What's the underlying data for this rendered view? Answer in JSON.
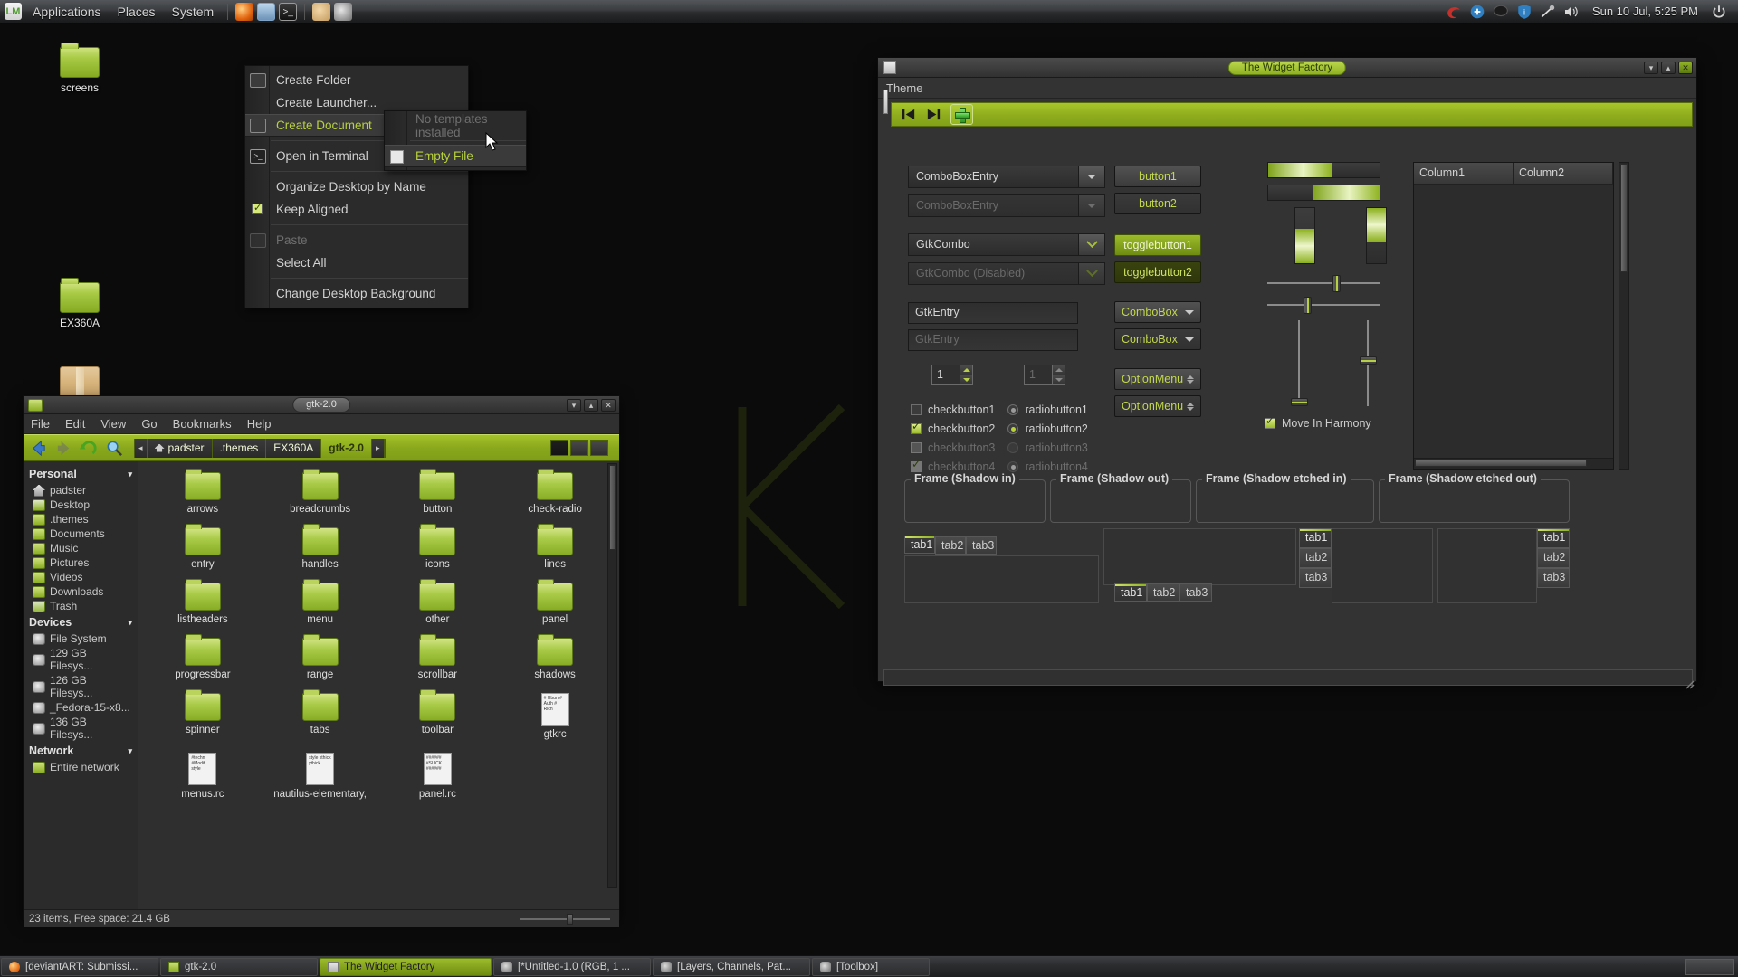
{
  "top_panel": {
    "logo": "lm-logo-icon",
    "menus": [
      "Applications",
      "Places",
      "System"
    ],
    "launchers": [
      "firefox-icon",
      "mail-icon",
      "terminal-icon",
      "gimp-icon",
      "color-picker-icon"
    ],
    "tray_icons": [
      "shutter-icon",
      "update-manager-icon",
      "chat-icon",
      "shield-icon",
      "network-icon",
      "volume-icon"
    ],
    "clock": "Sun 10 Jul,  5:25 PM",
    "power": "power-icon"
  },
  "desktop": {
    "icons": [
      {
        "label": "screens",
        "type": "folder"
      },
      {
        "label": "EX360A",
        "type": "folder"
      },
      {
        "label": "",
        "type": "archive"
      }
    ]
  },
  "context_menu": {
    "items": [
      {
        "label": "Create Folder",
        "icon": "new-folder-icon",
        "state": "normal",
        "mnemonic": "F"
      },
      {
        "label": "Create Launcher...",
        "icon": "",
        "state": "normal",
        "mnemonic": "L"
      },
      {
        "label": "Create Document",
        "icon": "new-document-icon",
        "state": "selected",
        "mnemonic": "D",
        "submenu": true
      },
      {
        "separator": true
      },
      {
        "label": "Open in Terminal",
        "icon": "terminal-icon",
        "state": "normal",
        "mnemonic": "T"
      },
      {
        "separator": true
      },
      {
        "label": "Organize Desktop by Name",
        "icon": "",
        "state": "normal",
        "mnemonic": "O"
      },
      {
        "label": "Keep Aligned",
        "icon": "checkbox-checked",
        "state": "normal",
        "mnemonic": "K"
      },
      {
        "separator": true
      },
      {
        "label": "Paste",
        "icon": "paste-icon",
        "state": "disabled",
        "mnemonic": "P"
      },
      {
        "label": "Select All",
        "icon": "",
        "state": "normal",
        "mnemonic": "A"
      },
      {
        "separator": true
      },
      {
        "label": "Change Desktop Background",
        "icon": "",
        "state": "normal",
        "mnemonic": "B"
      }
    ]
  },
  "context_submenu": {
    "items": [
      {
        "label": "No templates installed",
        "state": "disabled"
      },
      {
        "separator": true
      },
      {
        "label": "Empty File",
        "icon": "empty-file-icon",
        "state": "selected",
        "mnemonic": "E"
      }
    ]
  },
  "nautilus": {
    "title": "gtk-2.0",
    "window_buttons": [
      "minimize",
      "maximize",
      "close"
    ],
    "menubar": [
      "File",
      "Edit",
      "View",
      "Go",
      "Bookmarks",
      "Help"
    ],
    "toolbar_icons": [
      "back-icon",
      "forward-icon",
      "reload-icon",
      "search-icon"
    ],
    "breadcrumbs": [
      "padster",
      ".themes",
      "EX360A",
      "gtk-2.0"
    ],
    "breadcrumb_active": "gtk-2.0",
    "sidebar": [
      {
        "header": "Personal"
      },
      {
        "label": "padster",
        "icon": "home-icon"
      },
      {
        "label": "Desktop",
        "icon": "desktop-icon"
      },
      {
        "label": ".themes",
        "icon": "folder-icon"
      },
      {
        "label": "Documents",
        "icon": "documents-icon"
      },
      {
        "label": "Music",
        "icon": "music-icon"
      },
      {
        "label": "Pictures",
        "icon": "pictures-icon"
      },
      {
        "label": "Videos",
        "icon": "videos-icon"
      },
      {
        "label": "Downloads",
        "icon": "downloads-icon"
      },
      {
        "label": "Trash",
        "icon": "trash-icon"
      },
      {
        "header": "Devices"
      },
      {
        "label": "File System",
        "icon": "disk-icon"
      },
      {
        "label": "129 GB Filesys...",
        "icon": "disk-icon"
      },
      {
        "label": "126 GB Filesys...",
        "icon": "disk-icon"
      },
      {
        "label": "_Fedora-15-x8...",
        "icon": "disk-icon"
      },
      {
        "label": "136 GB Filesys...",
        "icon": "disk-icon"
      },
      {
        "header": "Network"
      },
      {
        "label": "Entire network",
        "icon": "network-icon"
      }
    ],
    "files": [
      {
        "name": "arrows",
        "type": "folder"
      },
      {
        "name": "breadcrumbs",
        "type": "folder"
      },
      {
        "name": "button",
        "type": "folder"
      },
      {
        "name": "check-radio",
        "type": "folder"
      },
      {
        "name": "entry",
        "type": "folder"
      },
      {
        "name": "handles",
        "type": "folder"
      },
      {
        "name": "icons",
        "type": "folder"
      },
      {
        "name": "lines",
        "type": "folder"
      },
      {
        "name": "listheaders",
        "type": "folder"
      },
      {
        "name": "menu",
        "type": "folder"
      },
      {
        "name": "other",
        "type": "folder"
      },
      {
        "name": "panel",
        "type": "folder"
      },
      {
        "name": "progressbar",
        "type": "folder"
      },
      {
        "name": "range",
        "type": "folder"
      },
      {
        "name": "scrollbar",
        "type": "folder"
      },
      {
        "name": "shadows",
        "type": "folder"
      },
      {
        "name": "spinner",
        "type": "folder"
      },
      {
        "name": "tabs",
        "type": "folder"
      },
      {
        "name": "toolbar",
        "type": "folder"
      },
      {
        "name": "gtkrc",
        "type": "text",
        "preview": "# Ubun\n# Auth\n# Rich"
      },
      {
        "name": "menus.rc",
        "type": "text",
        "preview": "#techn\n#Modif\nstyle"
      },
      {
        "name": "nautilus-elementary,",
        "type": "text",
        "preview": "style\nxthick\nythick"
      },
      {
        "name": "panel.rc",
        "type": "text",
        "preview": "######\n#SLICK\n######"
      }
    ],
    "statusbar": "23 items, Free space: 21.4 GB"
  },
  "widget_factory": {
    "title": "The Widget Factory",
    "menubar": [
      "Theme"
    ],
    "toolbar_icons": [
      "goto-first-icon",
      "goto-last-icon",
      "add-icon"
    ],
    "combos": [
      {
        "value": "ComboBoxEntry",
        "style": "entry",
        "state": "normal"
      },
      {
        "value": "ComboBoxEntry",
        "style": "entry",
        "state": "disabled"
      },
      {
        "value": "GtkCombo",
        "style": "combo",
        "state": "normal"
      },
      {
        "value": "GtkCombo (Disabled)",
        "style": "combo",
        "state": "disabled"
      }
    ],
    "entries": [
      {
        "value": "GtkEntry",
        "state": "normal"
      },
      {
        "value": "GtkEntry",
        "state": "disabled"
      }
    ],
    "spinners": [
      {
        "value": "1",
        "state": "normal"
      },
      {
        "value": "1",
        "state": "disabled"
      }
    ],
    "checkbuttons": [
      {
        "label": "checkbutton1",
        "checked": false,
        "state": "normal"
      },
      {
        "label": "checkbutton2",
        "checked": true,
        "state": "normal"
      },
      {
        "label": "checkbutton3",
        "checked": false,
        "state": "disabled"
      },
      {
        "label": "checkbutton4",
        "checked": true,
        "state": "disabled"
      }
    ],
    "radiobuttons": [
      {
        "label": "radiobutton1",
        "selected": false,
        "state": "normal"
      },
      {
        "label": "radiobutton2",
        "selected": true,
        "state": "normal"
      },
      {
        "label": "radiobutton3",
        "selected": false,
        "state": "disabled"
      },
      {
        "label": "radiobutton4",
        "selected": true,
        "state": "disabled"
      }
    ],
    "buttons": [
      {
        "label": "button1",
        "style": "normal"
      },
      {
        "label": "button2",
        "style": "flat"
      },
      {
        "label": "togglebutton1",
        "style": "toggle-on"
      },
      {
        "label": "togglebutton2",
        "style": "toggle-off"
      },
      {
        "label": "ComboBox",
        "style": "combo"
      },
      {
        "label": "ComboBox",
        "style": "combo"
      },
      {
        "label": "OptionMenu",
        "style": "option"
      },
      {
        "label": "OptionMenu",
        "style": "option"
      }
    ],
    "progress": [
      {
        "orientation": "horizontal",
        "percent": 57
      },
      {
        "orientation": "horizontal-rtl",
        "percent": 60
      },
      {
        "orientation": "vertical",
        "percent": 62
      },
      {
        "orientation": "vertical-top",
        "percent": 60
      }
    ],
    "move_in_harmony": {
      "label": "Move In Harmony",
      "checked": true
    },
    "treeview": {
      "columns": [
        "Column1",
        "Column2"
      ],
      "rows": []
    },
    "frames": [
      "Frame (Shadow in)",
      "Frame (Shadow out)",
      "Frame (Shadow etched in)",
      "Frame (Shadow etched out)"
    ],
    "notebooks": [
      {
        "position": "top",
        "tabs": [
          "tab1",
          "tab2",
          "tab3"
        ],
        "active": "tab1"
      },
      {
        "position": "bottom",
        "tabs": [
          "tab1",
          "tab2",
          "tab3"
        ],
        "active": "tab1"
      },
      {
        "position": "left",
        "tabs": [
          "tab1",
          "tab2",
          "tab3"
        ],
        "active": "tab1"
      },
      {
        "position": "right",
        "tabs": [
          "tab1",
          "tab2",
          "tab3"
        ],
        "active": "tab1"
      }
    ]
  },
  "bottom_panel": {
    "tasks": [
      {
        "label": "[deviantART: Submissi...",
        "icon": "firefox-icon",
        "active": false
      },
      {
        "label": "gtk-2.0",
        "icon": "folder-icon",
        "active": false
      },
      {
        "label": "The Widget Factory",
        "icon": "window-icon",
        "active": true
      },
      {
        "label": "[*Untitled-1.0 (RGB, 1 ...",
        "icon": "gimp-icon",
        "active": false
      },
      {
        "label": "[Layers, Channels, Pat...",
        "icon": "gimp-icon",
        "active": false
      },
      {
        "label": "[Toolbox]",
        "icon": "gimp-icon",
        "active": false
      }
    ],
    "show_desktop": "show-desktop-button"
  },
  "colors": {
    "accent_green": "#9cbb2a",
    "accent_green_light": "#cfe06a",
    "window_bg": "#333333",
    "panel_bg": "#2c2e30",
    "text": "#cfcfcf"
  }
}
